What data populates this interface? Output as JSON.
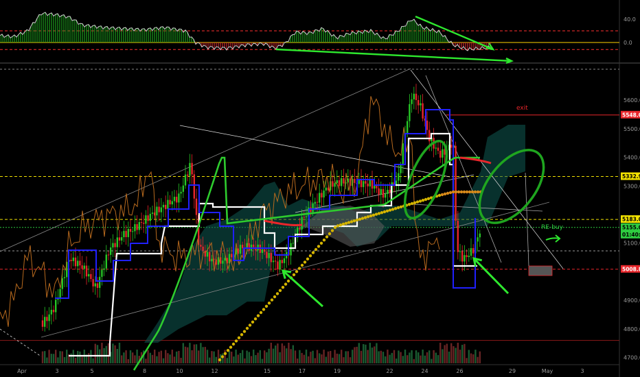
{
  "chart_data": {
    "type": "candlestick",
    "oscillator": {
      "yticks": [
        {
          "label": "40.0",
          "value": 40
        },
        {
          "label": "0.0",
          "value": 0
        }
      ],
      "levels": [
        {
          "value": 20,
          "color": "#ff3030"
        },
        {
          "value": 0,
          "color": "#ffd400"
        },
        {
          "value": -12,
          "color": "#ff3030"
        }
      ]
    },
    "price_axis": {
      "ylim": [
        4680,
        5720
      ],
      "ticks": [
        {
          "label": "5600.0",
          "value": 5600
        },
        {
          "label": "5500.0",
          "value": 5500
        },
        {
          "label": "5400.0",
          "value": 5400
        },
        {
          "label": "5300.0",
          "value": 5300
        },
        {
          "label": "5100.0",
          "value": 5100
        },
        {
          "label": "4900.0",
          "value": 4900
        },
        {
          "label": "4800.0",
          "value": 4800
        },
        {
          "label": "4700.0",
          "value": 4700
        }
      ],
      "tags": [
        {
          "label": "5548.0",
          "value": 5548,
          "color": "#e8262b",
          "text": "white"
        },
        {
          "label": "5332.9",
          "value": 5332.9,
          "color": "#f2e200",
          "text": "black"
        },
        {
          "label": "5183.0",
          "value": 5183,
          "color": "#f2e200",
          "text": "black"
        },
        {
          "label": "5155.0",
          "value": 5155,
          "color": "#2ecc40",
          "text": "black",
          "sub": "01:40:22"
        },
        {
          "label": "5008.8",
          "value": 5008.8,
          "color": "#e8262b",
          "text": "white"
        }
      ],
      "hlines": [
        {
          "value": 5548,
          "color": "#e8262b",
          "dash": "",
          "x_from": 0.72
        },
        {
          "value": 5332.9,
          "color": "#f2e200",
          "dash": "4,3",
          "x_from": 0
        },
        {
          "value": 5183,
          "color": "#f2e200",
          "dash": "4,3",
          "x_from": 0
        },
        {
          "value": 5155,
          "color": "#2ecc40",
          "dash": "2,2",
          "x_from": 0
        },
        {
          "value": 5008.8,
          "color": "#e8262b",
          "dash": "4,3",
          "x_from": 0
        },
        {
          "value": 4760,
          "color": "#8b1a1a",
          "dash": "",
          "x_from": 0
        }
      ]
    },
    "x_ticks": [
      {
        "label": "Apr",
        "day": 1
      },
      {
        "label": "3",
        "day": 3
      },
      {
        "label": "5",
        "day": 5
      },
      {
        "label": "8",
        "day": 8
      },
      {
        "label": "10",
        "day": 10
      },
      {
        "label": "12",
        "day": 12
      },
      {
        "label": "15",
        "day": 15
      },
      {
        "label": "17",
        "day": 17
      },
      {
        "label": "19",
        "day": 19
      },
      {
        "label": "22",
        "day": 22
      },
      {
        "label": "24",
        "day": 24
      },
      {
        "label": "26",
        "day": 26
      },
      {
        "label": "29",
        "day": 29
      },
      {
        "label": "May",
        "day": 31
      },
      {
        "label": "3",
        "day": 33
      }
    ],
    "annotations": [
      {
        "text": "exit",
        "color": "#e8262b"
      },
      {
        "text": "RE-buy",
        "color": "#2ecc40"
      }
    ],
    "colors": {
      "bull": "#26c826",
      "bear": "#e8262b",
      "kijun": "#ffffff",
      "tenkan": "#2020ff",
      "cloud": "#0f5a52",
      "ma_green": "#2ecc2e",
      "ma_yellow": "#d4b400",
      "lagging": "#b86a1e"
    }
  }
}
